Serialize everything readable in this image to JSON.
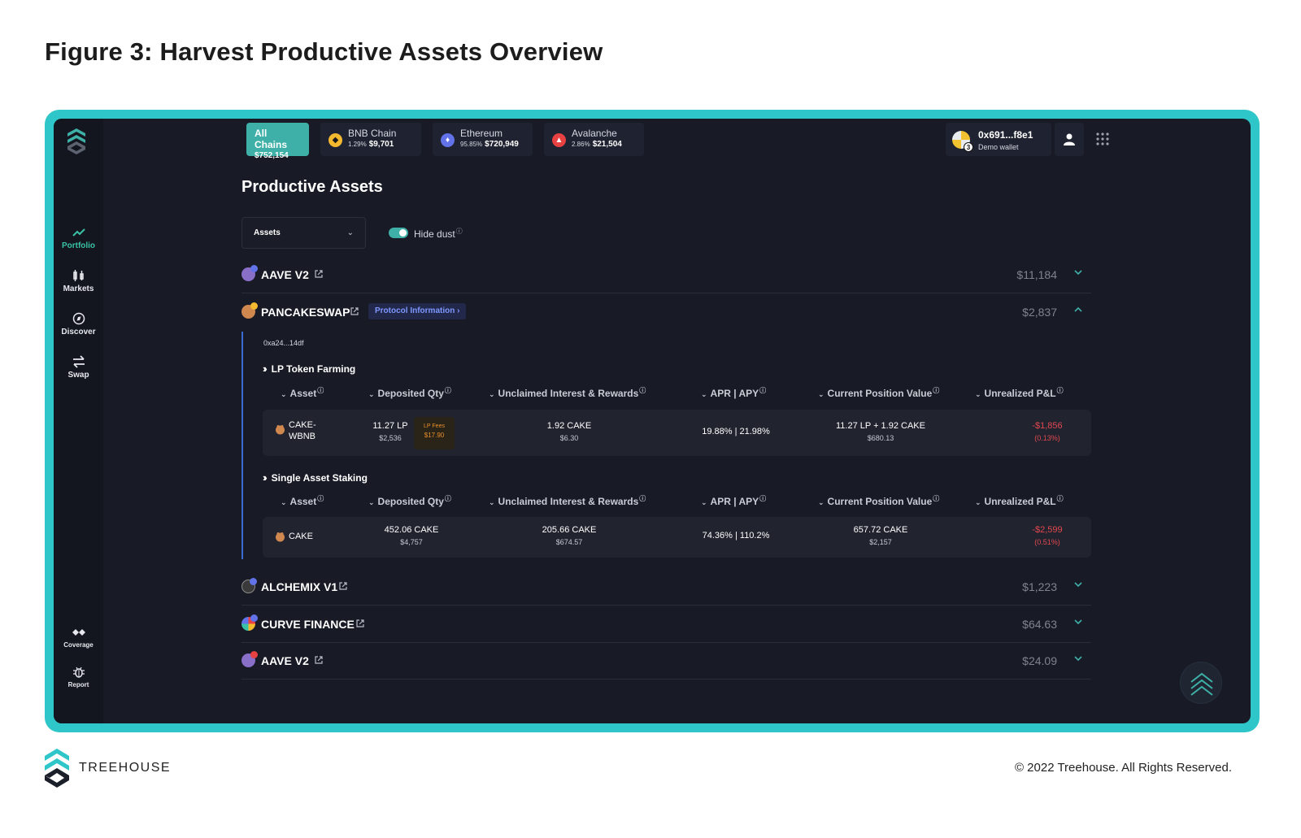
{
  "figure": {
    "title": "Figure 3: Harvest Productive Assets Overview"
  },
  "sidebar": {
    "items": [
      {
        "label": "Portfolio",
        "icon": "chart-line-icon"
      },
      {
        "label": "Markets",
        "icon": "candlestick-icon"
      },
      {
        "label": "Discover",
        "icon": "compass-icon"
      },
      {
        "label": "Swap",
        "icon": "swap-arrows-icon"
      },
      {
        "label": "Coverage",
        "icon": "handshake-icon"
      },
      {
        "label": "Report",
        "icon": "bug-icon"
      }
    ]
  },
  "chains": [
    {
      "name": "All Chains",
      "amount": "$752,154"
    },
    {
      "name": "BNB Chain",
      "pct": "1.29%",
      "amount": "$9,701",
      "color": "#f3ba2f"
    },
    {
      "name": "Ethereum",
      "pct": "95.85%",
      "amount": "$720,949",
      "color": "#6272e8"
    },
    {
      "name": "Avalanche",
      "pct": "2.86%",
      "amount": "$21,504",
      "color": "#e84142"
    }
  ],
  "wallet": {
    "address": "0x691...f8e1",
    "label": "Demo wallet",
    "badge": "3"
  },
  "page": {
    "title": "Productive Assets"
  },
  "filters": {
    "select_value": "Assets",
    "hide_dust_label": "Hide dust",
    "info": "ⓘ"
  },
  "protocols": [
    {
      "name": "AAVE V2",
      "value": "$11,184"
    },
    {
      "name": "PANCAKESWAP",
      "value": "$2,837",
      "info_label": "Protocol Information"
    },
    {
      "name": "ALCHEMIX V1",
      "value": "$1,223"
    },
    {
      "name": "CURVE FINANCE",
      "value": "$64.63"
    },
    {
      "name": "AAVE V2",
      "value": "$24.09"
    }
  ],
  "pancakeswap": {
    "account": "0xa24...14df",
    "columns": [
      "Asset",
      "Deposited Qty",
      "Unclaimed Interest & Rewards",
      "APR | APY",
      "Current Position Value",
      "Unrealized P&L"
    ],
    "sections": [
      {
        "title": "LP Token Farming",
        "row": {
          "asset_line1": "CAKE-",
          "asset_line2": "WBNB",
          "deposited": "11.27 LP",
          "deposited_usd": "$2,536",
          "lp_fees_label": "LP Fees",
          "lp_fees_value": "$17.90",
          "unclaimed": "1.92 CAKE",
          "unclaimed_usd": "$6.30",
          "apr_apy": "19.88% | 21.98%",
          "position": "11.27 LP + 1.92 CAKE",
          "position_usd": "$680.13",
          "pnl": "-$1,856",
          "pnl_pct": "(0.13%)"
        }
      },
      {
        "title": "Single Asset Staking",
        "row": {
          "asset_line1": "CAKE",
          "deposited": "452.06 CAKE",
          "deposited_usd": "$4,757",
          "unclaimed": "205.66 CAKE",
          "unclaimed_usd": "$674.57",
          "apr_apy": "74.36% | 110.2%",
          "position": "657.72 CAKE",
          "position_usd": "$2,157",
          "pnl": "-$2,599",
          "pnl_pct": "(0.51%)"
        }
      }
    ]
  },
  "footer": {
    "brand": "TREEHOUSE",
    "copyright": "© 2022 Treehouse. All Rights Reserved."
  },
  "colors": {
    "accent": "#2ec6c8",
    "teal": "#3fb0a8",
    "negative": "#e3474f",
    "background": "#181b26"
  }
}
